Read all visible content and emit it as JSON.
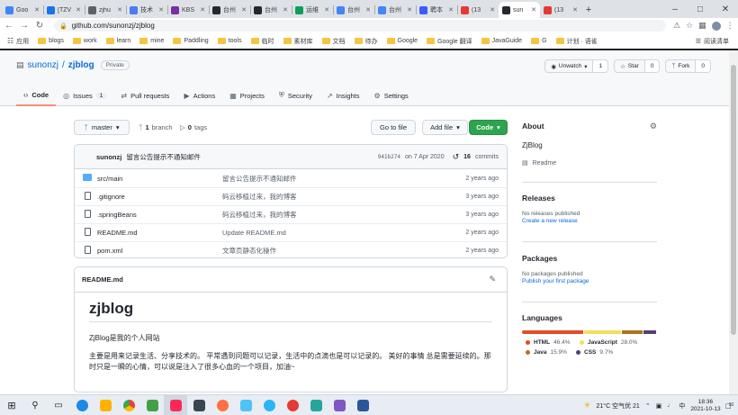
{
  "browser": {
    "tabs": [
      {
        "label": "Goo",
        "icon": "google-icon",
        "color": "#4285f4"
      },
      {
        "label": "[TZV",
        "icon": "app-icon",
        "color": "#1a73e8"
      },
      {
        "label": "zjhu",
        "icon": "globe-icon",
        "color": "#5f6368"
      },
      {
        "label": "技术",
        "icon": "app-icon",
        "color": "#4b7bec"
      },
      {
        "label": "KBS",
        "icon": "app-icon",
        "color": "#7a2ea0"
      },
      {
        "label": "台州",
        "icon": "github-icon",
        "color": "#24292f"
      },
      {
        "label": "台州",
        "icon": "github-icon",
        "color": "#24292f"
      },
      {
        "label": "运维",
        "icon": "app-icon",
        "color": "#0f9d58"
      },
      {
        "label": "台州",
        "icon": "app-icon",
        "color": "#4285f4"
      },
      {
        "label": "台州",
        "icon": "app-icon",
        "color": "#4285f4"
      },
      {
        "label": "聘本",
        "icon": "app-icon",
        "color": "#3d5afe"
      },
      {
        "label": "(13",
        "icon": "csdn-icon",
        "color": "#e53935"
      },
      {
        "label": "sun",
        "icon": "github-icon",
        "color": "#24292f",
        "active": true
      },
      {
        "label": "(13",
        "icon": "csdn-icon",
        "color": "#e53935"
      }
    ],
    "url": "github.com/sunonzj/zjblog",
    "bookmarks": [
      "应用",
      "blogs",
      "work",
      "learn",
      "mine",
      "Paddling",
      "tools",
      "临时",
      "素材库",
      "文档",
      "待办",
      "Google",
      "Google 翻译",
      "JavaGuide",
      "G",
      "计划 · 语雀"
    ],
    "reading_list": "阅读清单"
  },
  "repo": {
    "owner": "sunonzj",
    "name": "zjblog",
    "visibility": "Private",
    "watch": {
      "label": "Unwatch",
      "count": "1"
    },
    "star": {
      "label": "Star",
      "count": "0"
    },
    "fork": {
      "label": "Fork",
      "count": "0"
    },
    "nav": [
      {
        "label": "Code",
        "icon": "code-icon",
        "active": true
      },
      {
        "label": "Issues",
        "icon": "issue-icon",
        "count": "1"
      },
      {
        "label": "Pull requests",
        "icon": "pull-request-icon"
      },
      {
        "label": "Actions",
        "icon": "actions-icon"
      },
      {
        "label": "Projects",
        "icon": "projects-icon"
      },
      {
        "label": "Security",
        "icon": "shield-icon"
      },
      {
        "label": "Insights",
        "icon": "graph-icon"
      },
      {
        "label": "Settings",
        "icon": "gear-icon"
      }
    ]
  },
  "filebar": {
    "branch": "master",
    "branches": "1",
    "branches_label": "branch",
    "tags": "0",
    "tags_label": "tags",
    "goto": "Go to file",
    "add": "Add file",
    "code": "Code"
  },
  "commit": {
    "author": "sunonzj",
    "message": "留言公告提示不通知邮件",
    "sha": "941b274",
    "date": "on 7 Apr 2020",
    "commits": "16",
    "commits_label": "commits"
  },
  "files": [
    {
      "name": "src/main",
      "type": "dir",
      "message": "留言公告提示不通知邮件",
      "age": "2 years ago"
    },
    {
      "name": ".gitignore",
      "type": "file",
      "message": "码云移植过来，我的博客",
      "age": "3 years ago"
    },
    {
      "name": ".springBeans",
      "type": "file",
      "message": "码云移植过来，我的博客",
      "age": "3 years ago"
    },
    {
      "name": "README.md",
      "type": "file",
      "message": "Update README.md",
      "age": "2 years ago"
    },
    {
      "name": "pom.xml",
      "type": "file",
      "message": "文章页静态化操作",
      "age": "2 years ago"
    }
  ],
  "readme": {
    "filename": "README.md",
    "title": "zjblog",
    "p1": "ZjBlog是我的个人网站",
    "p2": "主要是用来记录生活、分享技术的。 平常遇到问题可以记录，生活中的点滴也是可以记录的。 美好的事情 总是需要延续的。那时只是一瞬的心情，可以说是注入了很多心血的一个项目，加油~"
  },
  "sidebar": {
    "about_title": "About",
    "description": "ZjBlog",
    "readme_link": "Readme",
    "releases_title": "Releases",
    "releases_text": "No releases published",
    "releases_link": "Create a new release",
    "packages_title": "Packages",
    "packages_text": "No packages published",
    "packages_link": "Publish your first package",
    "languages_title": "Languages",
    "languages": [
      {
        "name": "HTML",
        "percent": "46.4%",
        "value": 46.4,
        "color": "#e34c26"
      },
      {
        "name": "JavaScript",
        "percent": "28.0%",
        "value": 28.0,
        "color": "#f1e05a"
      },
      {
        "name": "Java",
        "percent": "15.9%",
        "value": 15.9,
        "color": "#b07219"
      },
      {
        "name": "CSS",
        "percent": "9.7%",
        "value": 9.7,
        "color": "#563d7c"
      }
    ]
  },
  "taskbar": {
    "weather": "21°C 空气优 21",
    "ime": "中",
    "time": "18:36",
    "date": "2021-10-13",
    "notification_count": "10"
  }
}
